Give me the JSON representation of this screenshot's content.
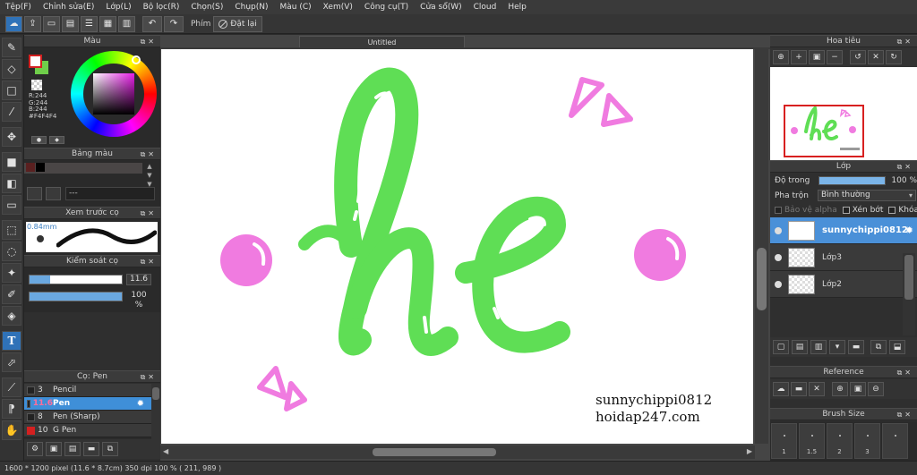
{
  "menu": [
    "Tệp(F)",
    "Chỉnh sửa(E)",
    "Lớp(L)",
    "Bộ lọc(R)",
    "Chọn(S)",
    "Chụp(N)",
    "Màu (C)",
    "Xem(V)",
    "Công cụ(T)",
    "Cửa sổ(W)",
    "Cloud",
    "Help"
  ],
  "toolbar": {
    "key_label": "Phím",
    "reset_label": "Đặt lại"
  },
  "panels": {
    "color": {
      "title": "Màu",
      "rgb_r": "R:244",
      "rgb_g": "G:244",
      "rgb_b": "B:244",
      "hex": "#F4F4F4",
      "fg_color": "#ffffff",
      "bg_color": "#6fce4a"
    },
    "palette": {
      "title": "Bảng màu",
      "field_text": "---"
    },
    "brush_preview": {
      "title": "Xem trước cọ",
      "size": "0.84mm"
    },
    "brush_control": {
      "title": "Kiểm soát cọ",
      "size_value": "11.6",
      "opacity_value": "100 %",
      "size_fraction": 0.22,
      "opacity_fraction": 1.0
    },
    "brushes": {
      "title": "Cọ: Pen",
      "items": [
        {
          "size": "3",
          "name": "Pencil",
          "color": "#222222"
        },
        {
          "size": "11.6",
          "name": "Pen",
          "color": "#222222",
          "selected": true
        },
        {
          "size": "8",
          "name": "Pen (Sharp)",
          "color": "#222222"
        },
        {
          "size": "10",
          "name": "G Pen",
          "color": "#d42020"
        }
      ]
    },
    "navigator": {
      "title": "Hoa tiêu"
    },
    "layer": {
      "title": "Lớp",
      "opacity_label": "Độ trong",
      "opacity_value": "100 %",
      "blend_label": "Pha trộn",
      "blend_value": "Bình thường",
      "protect_alpha": "Bảo vệ alpha",
      "clipping": "Xén bớt",
      "lock": "Khóa",
      "layers": [
        {
          "name": "sunnychippi0812",
          "selected": true
        },
        {
          "name": "Lớp3"
        },
        {
          "name": "Lớp2"
        }
      ]
    },
    "reference": {
      "title": "Reference"
    },
    "brush_size": {
      "title": "Brush Size",
      "sizes": [
        "1",
        "1.5",
        "2",
        "3",
        ""
      ]
    }
  },
  "canvas": {
    "doc_title": "Untitled",
    "watermark_line1": "sunnychippi0812",
    "watermark_line2": "hoidap247.com",
    "artwork_colors": {
      "green": "#5fde55",
      "pink": "#f07be0",
      "highlight": "#ffffff"
    }
  },
  "status": {
    "text": "1600 * 1200 pixel  (11.6 * 8.7cm)  350 dpi  100 %  ( 211, 989 )"
  }
}
